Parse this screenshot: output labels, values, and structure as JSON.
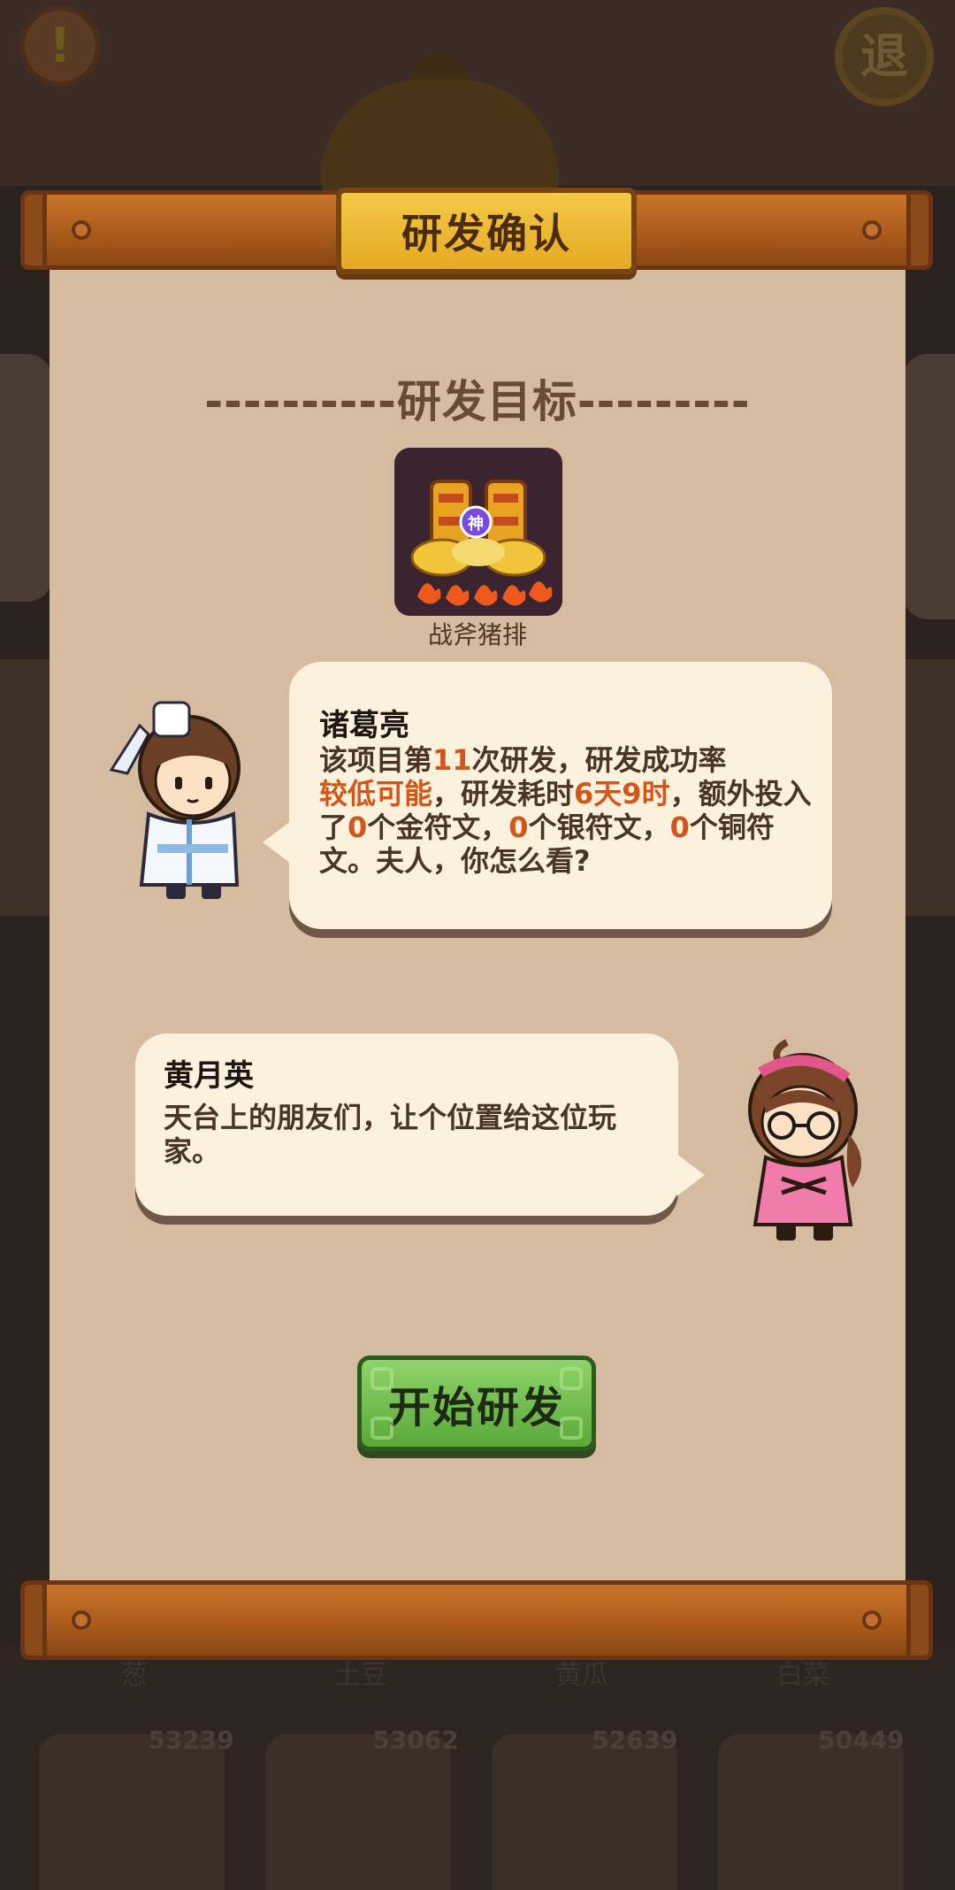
{
  "background": {
    "exit_label": "退",
    "crop_labels": [
      "葱",
      "土豆",
      "黄瓜",
      "白菜"
    ],
    "crop_scores": [
      "53239",
      "53062",
      "52639",
      "50449"
    ]
  },
  "dialog": {
    "title": "研发确认",
    "section_heading": "----------研发目标---------",
    "item": {
      "name": "战斧猪排",
      "badge": "神"
    },
    "zhuge": {
      "speaker": "诸葛亮",
      "speech_parts": {
        "p1": "该项目第",
        "count": "11",
        "p2": "次研发，研发成功率",
        "rate": "较低可能",
        "p3": "，研发耗时",
        "time": "6天9时",
        "p4": "，额外投入了",
        "gold": "0",
        "p5": "个金符文，",
        "silver": "0",
        "p6": "个银符文，",
        "copper": "0",
        "p7": "个铜符文。夫人，你怎么看?"
      }
    },
    "huang": {
      "speaker": "黄月英",
      "speech": "天台上的朋友们，让个位置给这位玩家。"
    },
    "start_button": "开始研发"
  },
  "colors": {
    "highlight": "#d2561a",
    "paper": "#d5bca1",
    "button": "#6cbc48",
    "plaque": "#f0bf3a"
  }
}
